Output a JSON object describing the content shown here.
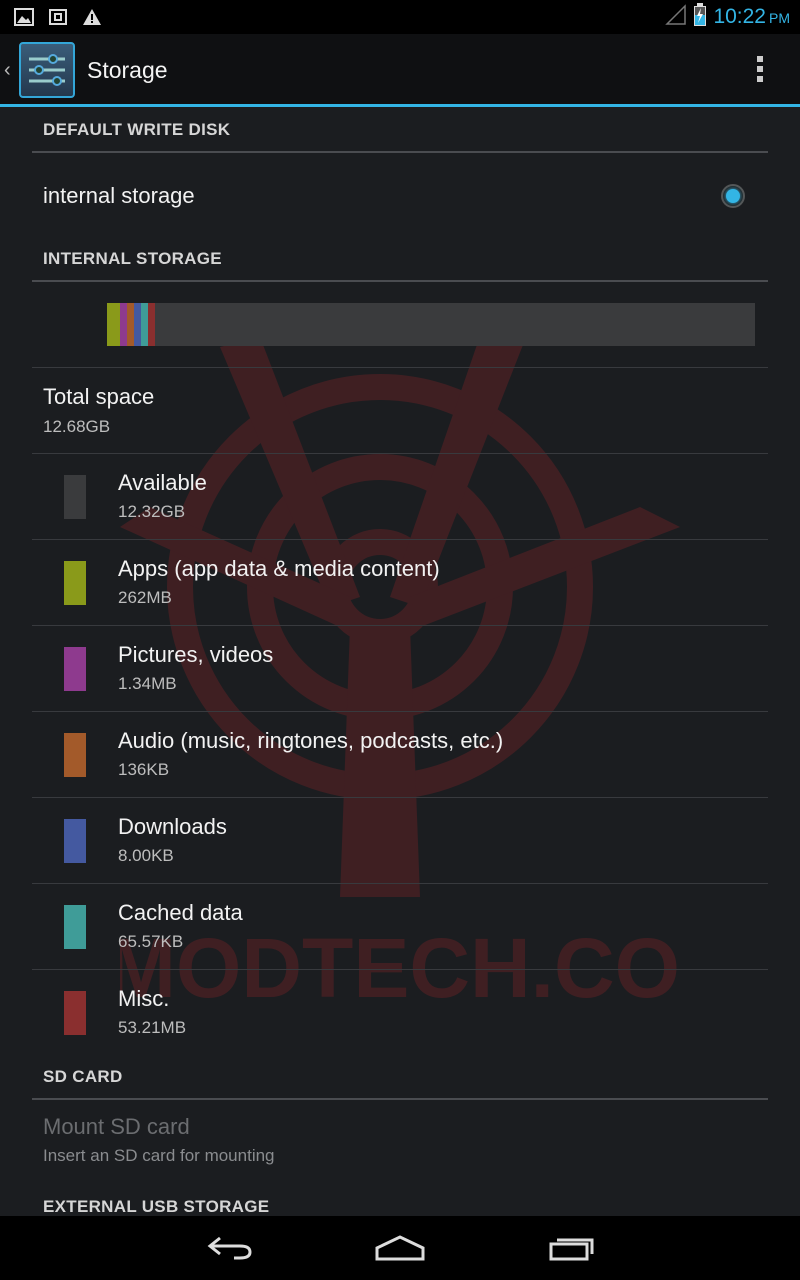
{
  "status_bar": {
    "time": "10:22",
    "ampm": "PM",
    "left_icons": [
      "gallery-icon",
      "sim-card-icon",
      "warning-icon"
    ],
    "right_icons": [
      "signal-icon",
      "battery-charging-icon"
    ],
    "accent": "#33b5e5"
  },
  "action_bar": {
    "title": "Storage",
    "app_icon": "settings-sliders-icon",
    "overflow_icon": "overflow-menu-icon"
  },
  "default_write_disk": {
    "header": "DEFAULT WRITE DISK",
    "option_label": "internal storage",
    "selected": true
  },
  "internal_storage": {
    "header": "INTERNAL STORAGE",
    "total_title": "Total space",
    "total_value": "12.68GB",
    "usage_bar_segments": [
      {
        "name": "Apps",
        "fraction": 0.0206,
        "color": "#8a9a1a"
      },
      {
        "name": "Pictures",
        "fraction": 0.0001,
        "color": "#8e3a8e"
      },
      {
        "name": "Audio",
        "fraction": 0.0001,
        "color": "#a35a2a"
      },
      {
        "name": "Downloads",
        "fraction": 0.0001,
        "color": "#4459a0"
      },
      {
        "name": "Cached",
        "fraction": 0.0001,
        "color": "#3f9c98"
      },
      {
        "name": "Misc",
        "fraction": 0.0042,
        "color": "#8a2f2f"
      }
    ],
    "items": [
      {
        "label": "Available",
        "size": "12.32GB",
        "color": "#3a3b3d"
      },
      {
        "label": "Apps (app data & media content)",
        "size": "262MB",
        "color": "#8a9a1a"
      },
      {
        "label": "Pictures, videos",
        "size": "1.34MB",
        "color": "#8e3a8e"
      },
      {
        "label": "Audio (music, ringtones, podcasts, etc.)",
        "size": "136KB",
        "color": "#a35a2a"
      },
      {
        "label": "Downloads",
        "size": "8.00KB",
        "color": "#4459a0"
      },
      {
        "label": "Cached data",
        "size": "65.57KB",
        "color": "#3f9c98"
      },
      {
        "label": "Misc.",
        "size": "53.21MB",
        "color": "#8a2f2f"
      }
    ]
  },
  "sd_card": {
    "header": "SD CARD",
    "mount_title": "Mount SD card",
    "mount_summary": "Insert an SD card for mounting"
  },
  "external_usb": {
    "header": "EXTERNAL USB STORAGE"
  },
  "watermark_text": "VMODTECH.COM",
  "nav_bar": {
    "back_icon": "back-icon",
    "home_icon": "home-icon",
    "recents_icon": "recent-apps-icon"
  }
}
